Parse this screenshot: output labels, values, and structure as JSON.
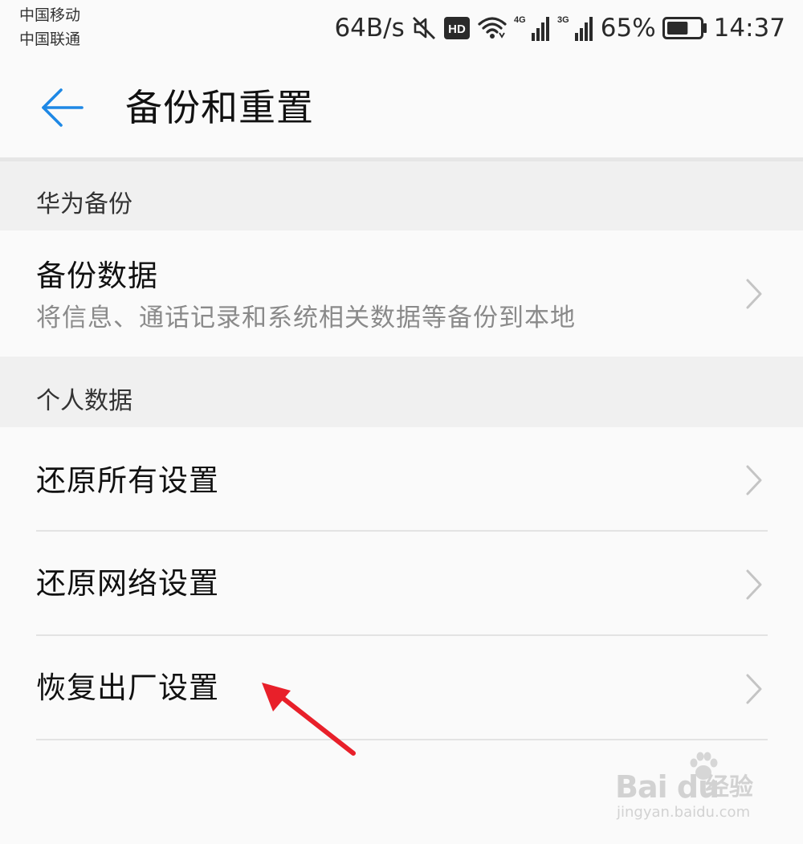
{
  "status_bar": {
    "carrier_1": "中国移动",
    "carrier_2": "中国联通",
    "network_speed": "64B/s",
    "hd_badge": "HD",
    "sim1_network": "4G",
    "sim2_network": "3G",
    "battery_percent": "65%",
    "battery_level": 0.65,
    "time": "14:37",
    "icons": [
      "mute-icon",
      "hd-icon",
      "wifi-icon",
      "signal-4g-icon",
      "signal-3g-icon",
      "battery-icon"
    ]
  },
  "header": {
    "title": "备份和重置",
    "back_icon": "arrow-left-icon"
  },
  "sections": [
    {
      "title": "华为备份",
      "items": [
        {
          "title": "备份数据",
          "subtitle": "将信息、通话记录和系统相关数据等备份到本地"
        }
      ]
    },
    {
      "title": "个人数据",
      "items": [
        {
          "title": "还原所有设置"
        },
        {
          "title": "还原网络设置"
        },
        {
          "title": "恢复出厂设置"
        }
      ]
    }
  ],
  "annotation": {
    "type": "red-arrow",
    "color": "#e8202a",
    "target": "恢复出厂设置"
  },
  "watermark": {
    "brand": "Bai du",
    "brand_cn": "经验",
    "url": "jingyan.baidu.com"
  },
  "colors": {
    "accent": "#1e88e5",
    "background": "#fafafa",
    "section_background": "#f0f0f0",
    "subtitle_text": "#8a8a8a",
    "chevron": "#c4c4c4"
  }
}
